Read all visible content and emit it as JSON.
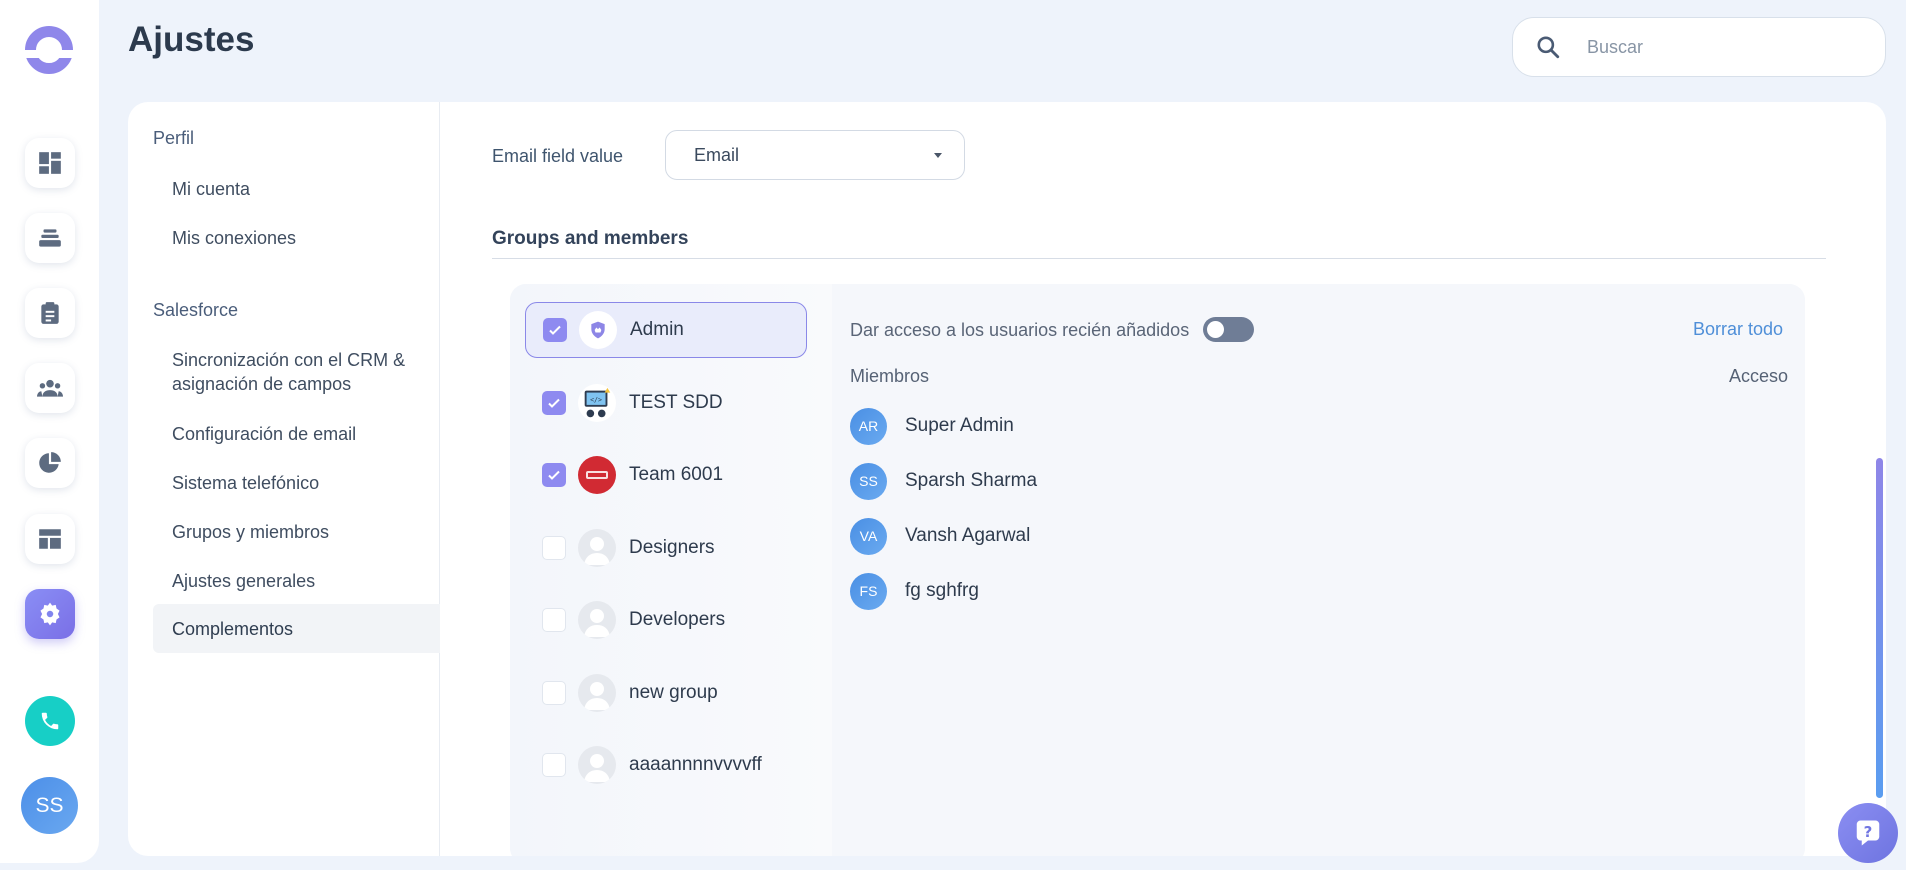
{
  "page": {
    "title": "Ajustes"
  },
  "search": {
    "placeholder": "Buscar"
  },
  "user": {
    "initials": "SS"
  },
  "settings_nav": {
    "section_profile": "Perfil",
    "profile_items": [
      "Mi cuenta",
      "Mis conexiones"
    ],
    "section_salesforce": "Salesforce",
    "salesforce_items": [
      "Sincronización con el CRM & asignación de campos",
      "Configuración de email",
      "Sistema telefónico",
      "Grupos y miembros",
      "Ajustes generales",
      "Complementos"
    ],
    "active": "Complementos"
  },
  "email_field": {
    "label": "Email field value",
    "value": "Email"
  },
  "groups_section": {
    "title": "Groups and members"
  },
  "groups": [
    {
      "name": "Admin",
      "checked": true,
      "selected": true,
      "icon": "shield-icon"
    },
    {
      "name": "TEST SDD",
      "checked": true,
      "icon": "developer-avatar-icon"
    },
    {
      "name": "Team 6001",
      "checked": true,
      "icon": "team-logo-icon"
    },
    {
      "name": "Designers",
      "checked": false,
      "icon": "person-placeholder-icon"
    },
    {
      "name": "Developers",
      "checked": false,
      "icon": "person-placeholder-icon"
    },
    {
      "name": "new group",
      "checked": false,
      "icon": "person-placeholder-icon"
    },
    {
      "name": "aaaannnnvvvvff",
      "checked": false,
      "icon": "person-placeholder-icon"
    }
  ],
  "members_panel": {
    "toggle_label": "Dar acceso a los usuarios recién añadidos",
    "toggle_on": false,
    "clear_all": "Borrar todo",
    "col_members": "Miembros",
    "col_access": "Acceso"
  },
  "members": [
    {
      "initials": "AR",
      "name": "Super Admin",
      "access": false
    },
    {
      "initials": "SS",
      "name": "Sparsh Sharma",
      "access": true
    },
    {
      "initials": "VA",
      "name": "Vansh Agarwal",
      "access": false
    },
    {
      "initials": "FS",
      "name": "fg sghfrg",
      "access": true
    }
  ],
  "colors": {
    "accent": "#8e8af0",
    "link": "#4f8fd8",
    "call": "#17cfc6"
  }
}
